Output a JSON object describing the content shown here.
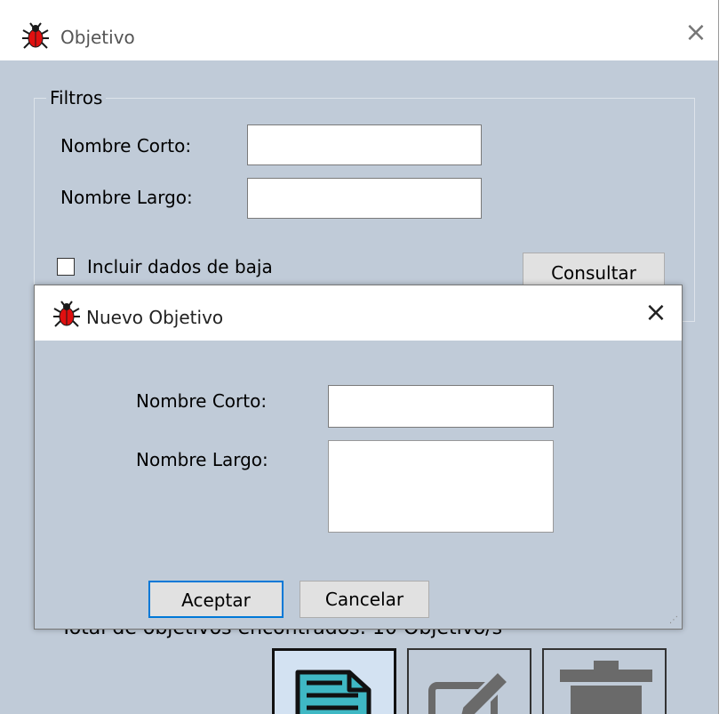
{
  "main_window": {
    "title": "Objetivo",
    "close_glyph": "×",
    "filters": {
      "legend": "Filtros",
      "short_name_label": "Nombre Corto:",
      "short_name_value": "",
      "long_name_label": "Nombre Largo:",
      "long_name_value": "",
      "include_inactive_label": "Incluir dados de baja",
      "include_inactive_checked": false,
      "query_button": "Consultar"
    },
    "total_text": "Total de objetivos encontrados: 10 Objetivo/s",
    "toolbar": [
      "details-icon",
      "edit-icon",
      "trash-icon"
    ]
  },
  "dialog": {
    "title": "Nuevo Objetivo",
    "close_glyph": "×",
    "short_name_label": "Nombre Corto:",
    "short_name_value": "",
    "long_name_label": "Nombre Largo:",
    "long_name_value": "",
    "accept_button": "Aceptar",
    "cancel_button": "Cancelar"
  },
  "colors": {
    "window_bg": "#c0cbd8",
    "titlebar_bg": "#ffffff",
    "app_icon": "#e01010",
    "focus_border": "#0078d7",
    "tool_selected_bg": "#d3e2f2",
    "doc_icon": "#3fb8c4"
  }
}
